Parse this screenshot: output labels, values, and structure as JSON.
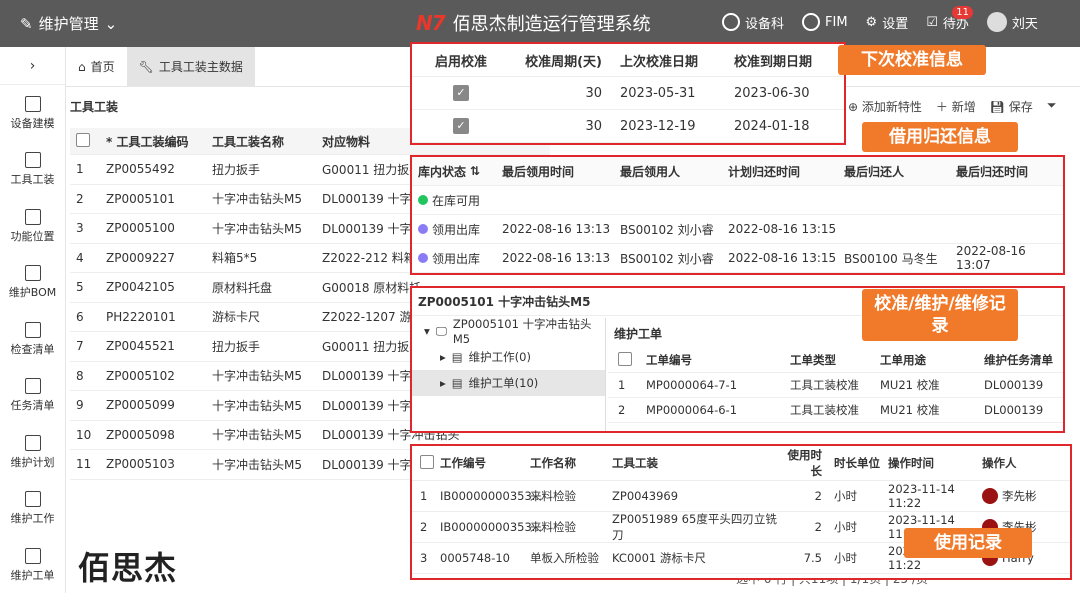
{
  "topbar": {
    "menu": "维护管理",
    "brand_logo": "N7",
    "brand_title": "佰思杰制造运行管理系统",
    "items": [
      {
        "label": "设备科",
        "icon": "globe-icon"
      },
      {
        "label": "FIM",
        "icon": "chat-icon"
      },
      {
        "label": "设置",
        "icon": "gear-icon"
      },
      {
        "label": "待办",
        "icon": "todo-icon",
        "badge": "11"
      },
      {
        "label": "刘天",
        "icon": "avatar-icon"
      }
    ]
  },
  "sidebar": {
    "collapse": "›",
    "items": [
      {
        "label": "设备建模"
      },
      {
        "label": "工具工装"
      },
      {
        "label": "功能位置"
      },
      {
        "label": "维护BOM"
      },
      {
        "label": "检查清单"
      },
      {
        "label": "任务清单"
      },
      {
        "label": "维护计划"
      },
      {
        "label": "维护工作"
      },
      {
        "label": "维护工单"
      }
    ]
  },
  "tabs": [
    {
      "label": "首页",
      "icon": "home-icon"
    },
    {
      "label": "工具工装主数据",
      "icon": "wrench-icon"
    }
  ],
  "main": {
    "title": "工具工装",
    "columns": [
      "* 工具工装编码",
      "工具工装名称",
      "对应物料"
    ],
    "rows": [
      [
        "1",
        "ZP0055492",
        "扭力扳手",
        "G00011 扭力扳手"
      ],
      [
        "2",
        "ZP0005101",
        "十字冲击钻头M5",
        "DL000139 十字冲"
      ],
      [
        "3",
        "ZP0005100",
        "十字冲击钻头M5",
        "DL000139 十字冲"
      ],
      [
        "4",
        "ZP0009227",
        "料箱5*5",
        "Z2022-212 料箱"
      ],
      [
        "5",
        "ZP0042105",
        "原材料托盘",
        "G00018 原材料托"
      ],
      [
        "6",
        "PH2220101",
        "游标卡尺",
        "Z2022-1207 游标"
      ],
      [
        "7",
        "ZP0045521",
        "扭力扳手",
        "G00011 扭力扳手"
      ],
      [
        "8",
        "ZP0005102",
        "十字冲击钻头M5",
        "DL000139 十字冲"
      ],
      [
        "9",
        "ZP0005099",
        "十字冲击钻头M5",
        "DL000139 十字冲"
      ],
      [
        "10",
        "ZP0005098",
        "十字冲击钻头M5",
        "DL000139 十字冲击钻头"
      ],
      [
        "11",
        "ZP0005103",
        "十字冲击钻头M5",
        "DL000139 十字冲击钻头"
      ]
    ],
    "toolbar": [
      "添加新特性",
      "新增",
      "保存"
    ],
    "pager": "选中 0 行 | 共11项 | 1/1页 | 25 /页"
  },
  "watermark": "佰思杰",
  "calibration": {
    "callout": "下次校准信息",
    "headers": [
      "启用校准",
      "校准周期(天)",
      "上次校准日期",
      "校准到期日期"
    ],
    "rows": [
      [
        "✓",
        "30",
        "2023-05-31",
        "2023-06-30"
      ],
      [
        "✓",
        "30",
        "2023-12-19",
        "2024-01-18"
      ]
    ]
  },
  "borrow": {
    "callout": "借用归还信息",
    "headers": [
      "库内状态",
      "最后领用时间",
      "最后领用人",
      "计划归还时间",
      "最后归还人",
      "最后归还时间"
    ],
    "rows": [
      {
        "status": "在库可用",
        "color": "#22c55e",
        "cells": [
          "",
          "",
          "",
          "",
          ""
        ]
      },
      {
        "status": "领用出库",
        "color": "#8b7cf6",
        "cells": [
          "2022-08-16 13:13",
          "BS00102 刘小睿",
          "2022-08-16 13:15",
          "",
          ""
        ]
      },
      {
        "status": "领用出库",
        "color": "#8b7cf6",
        "cells": [
          "2022-08-16 13:13",
          "BS00102 刘小睿",
          "2022-08-16 13:15",
          "BS00100 马冬生",
          "2022-08-16 13:07"
        ]
      }
    ]
  },
  "maintenance": {
    "callout": "校准/维护/维修记录",
    "title": "ZP0005101 十字冲击钻头M5",
    "tree": [
      {
        "label": "ZP0005101 十字冲击钻头M5",
        "level": 0,
        "arrow": "▾"
      },
      {
        "label": "维护工作(0)",
        "level": 1,
        "arrow": "▸"
      },
      {
        "label": "维护工单(10)",
        "level": 1,
        "arrow": "▸"
      }
    ],
    "subtitle": "维护工单",
    "headers": [
      "工单编号",
      "工单类型",
      "工单用途",
      "维护任务清单"
    ],
    "rows": [
      [
        "1",
        "MP0000064-7-1",
        "工具工装校准",
        "MU21 校准",
        "DL000139"
      ],
      [
        "2",
        "MP0000064-6-1",
        "工具工装校准",
        "MU21 校准",
        "DL000139"
      ]
    ]
  },
  "usage": {
    "callout": "使用记录",
    "headers": [
      "工作编号",
      "工作名称",
      "工具工装",
      "使用时长",
      "时长单位",
      "操作时间",
      "操作人"
    ],
    "rows": [
      [
        "1",
        "IB00000000353...",
        "来料检验",
        "ZP0043969",
        "2",
        "小时",
        "2023-11-14 11:22",
        "李先彬"
      ],
      [
        "2",
        "IB00000000353...",
        "来料检验",
        "ZP0051989 65度平头四刃立铣刀",
        "2",
        "小时",
        "2023-11-14 11:22",
        "李先彬"
      ],
      [
        "3",
        "0005748-10",
        "单板入所检验",
        "KC0001 游标卡尺",
        "7.5",
        "小时",
        "2023-11-14 11:22",
        "Harry"
      ]
    ]
  }
}
